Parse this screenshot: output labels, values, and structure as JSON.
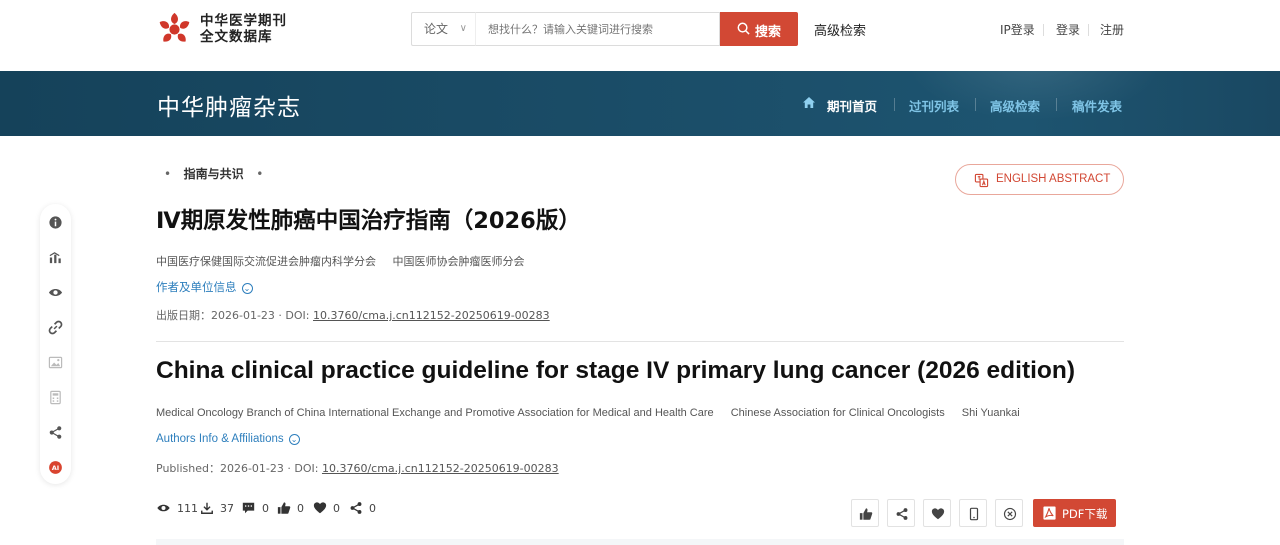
{
  "header": {
    "logo_line1": "中华医学期刊",
    "logo_line2": "全文数据库",
    "search_type": "论文",
    "search_placeholder": "想找什么？请输入关键词进行搜索",
    "search_button": "搜索",
    "advanced_search": "高级检索",
    "ip_login": "IP登录",
    "login": "登录",
    "register": "注册"
  },
  "banner": {
    "journal_name": "中华肿瘤杂志",
    "nav": [
      "期刊首页",
      "过刊列表",
      "高级检索",
      "稿件发表"
    ]
  },
  "sidebar": {
    "icons": [
      "info-icon",
      "metrics-icon",
      "view-icon",
      "link-icon",
      "image-icon",
      "calculator-icon",
      "share-icon",
      "ai-icon"
    ],
    "ai_label": "AI"
  },
  "article": {
    "column": "指南与共识",
    "en_abstract_button": "ENGLISH ABSTRACT",
    "title_cn": "Ⅳ期原发性肺癌中国治疗指南（2026版）",
    "authors_cn": [
      "中国医疗保健国际交流促进会肿瘤内科学分会",
      "中国医师协会肿瘤医师分会"
    ],
    "aff_cn": "作者及单位信息",
    "pub_cn_prefix": "出版日期：2026-01-23 · DOI:",
    "doi": "10.3760/cma.j.cn112152-20250619-00283",
    "title_en": "China clinical practice guideline for stage IV primary lung cancer (2026 edition)",
    "authors_en": [
      "Medical Oncology Branch of China International Exchange and Promotive Association for Medical and Health Care",
      "Chinese Association for Clinical Oncologists",
      "Shi Yuankai"
    ],
    "aff_en": "Authors Info & Affiliations",
    "pub_en_prefix": "Published：2026-01-23 · DOI:"
  },
  "stats": {
    "views": "111",
    "downloads": "37",
    "comments": "0",
    "likes": "0",
    "favorites": "0",
    "shares": "0"
  },
  "actions": {
    "pdf_download": "PDF下载"
  },
  "colors": {
    "accent_red": "#d24834",
    "banner_blue": "#1b4e69",
    "link_blue": "#2e7fbd"
  }
}
